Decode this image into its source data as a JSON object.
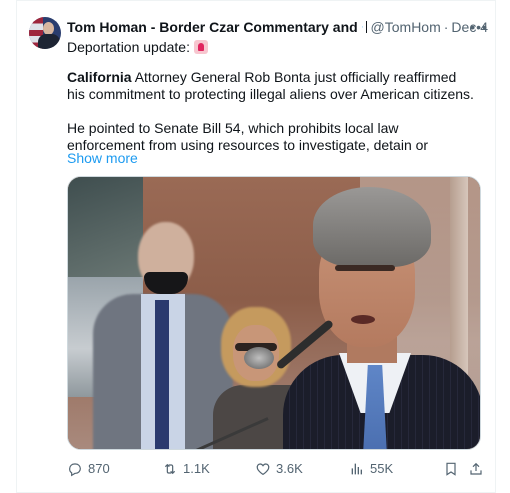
{
  "tweet": {
    "display_name": "Tom Homan - Border Czar Commentary and",
    "handle": "@TomHom",
    "separator": "·",
    "date": "Dec 4",
    "more_label": "•••",
    "subtitle": "Deportation update:",
    "paragraph1_bold": "California",
    "paragraph1_rest": " Attorney General Rob Bonta just officially reaffirmed his commitment to protecting illegal aliens over American citizens.",
    "paragraph2": "He pointed to Senate Bill 54, which prohibits local law enforcement from using resources to investigate, detain or",
    "show_more": "Show more"
  },
  "actions": {
    "replies": "870",
    "reposts": "1.1K",
    "likes": "3.6K",
    "views": "55K"
  },
  "colors": {
    "text": "#0f1419",
    "muted": "#536471",
    "accent": "#1d9bf0",
    "border": "#eff3f4"
  },
  "icons": {
    "verified": "verified-badge-icon",
    "affiliation": "affiliation-badge-icon",
    "siren": "rotating-light-emoji",
    "reply": "reply-icon",
    "repost": "repost-icon",
    "like": "heart-icon",
    "views": "views-chart-icon",
    "bookmark": "bookmark-icon",
    "share": "share-icon"
  }
}
